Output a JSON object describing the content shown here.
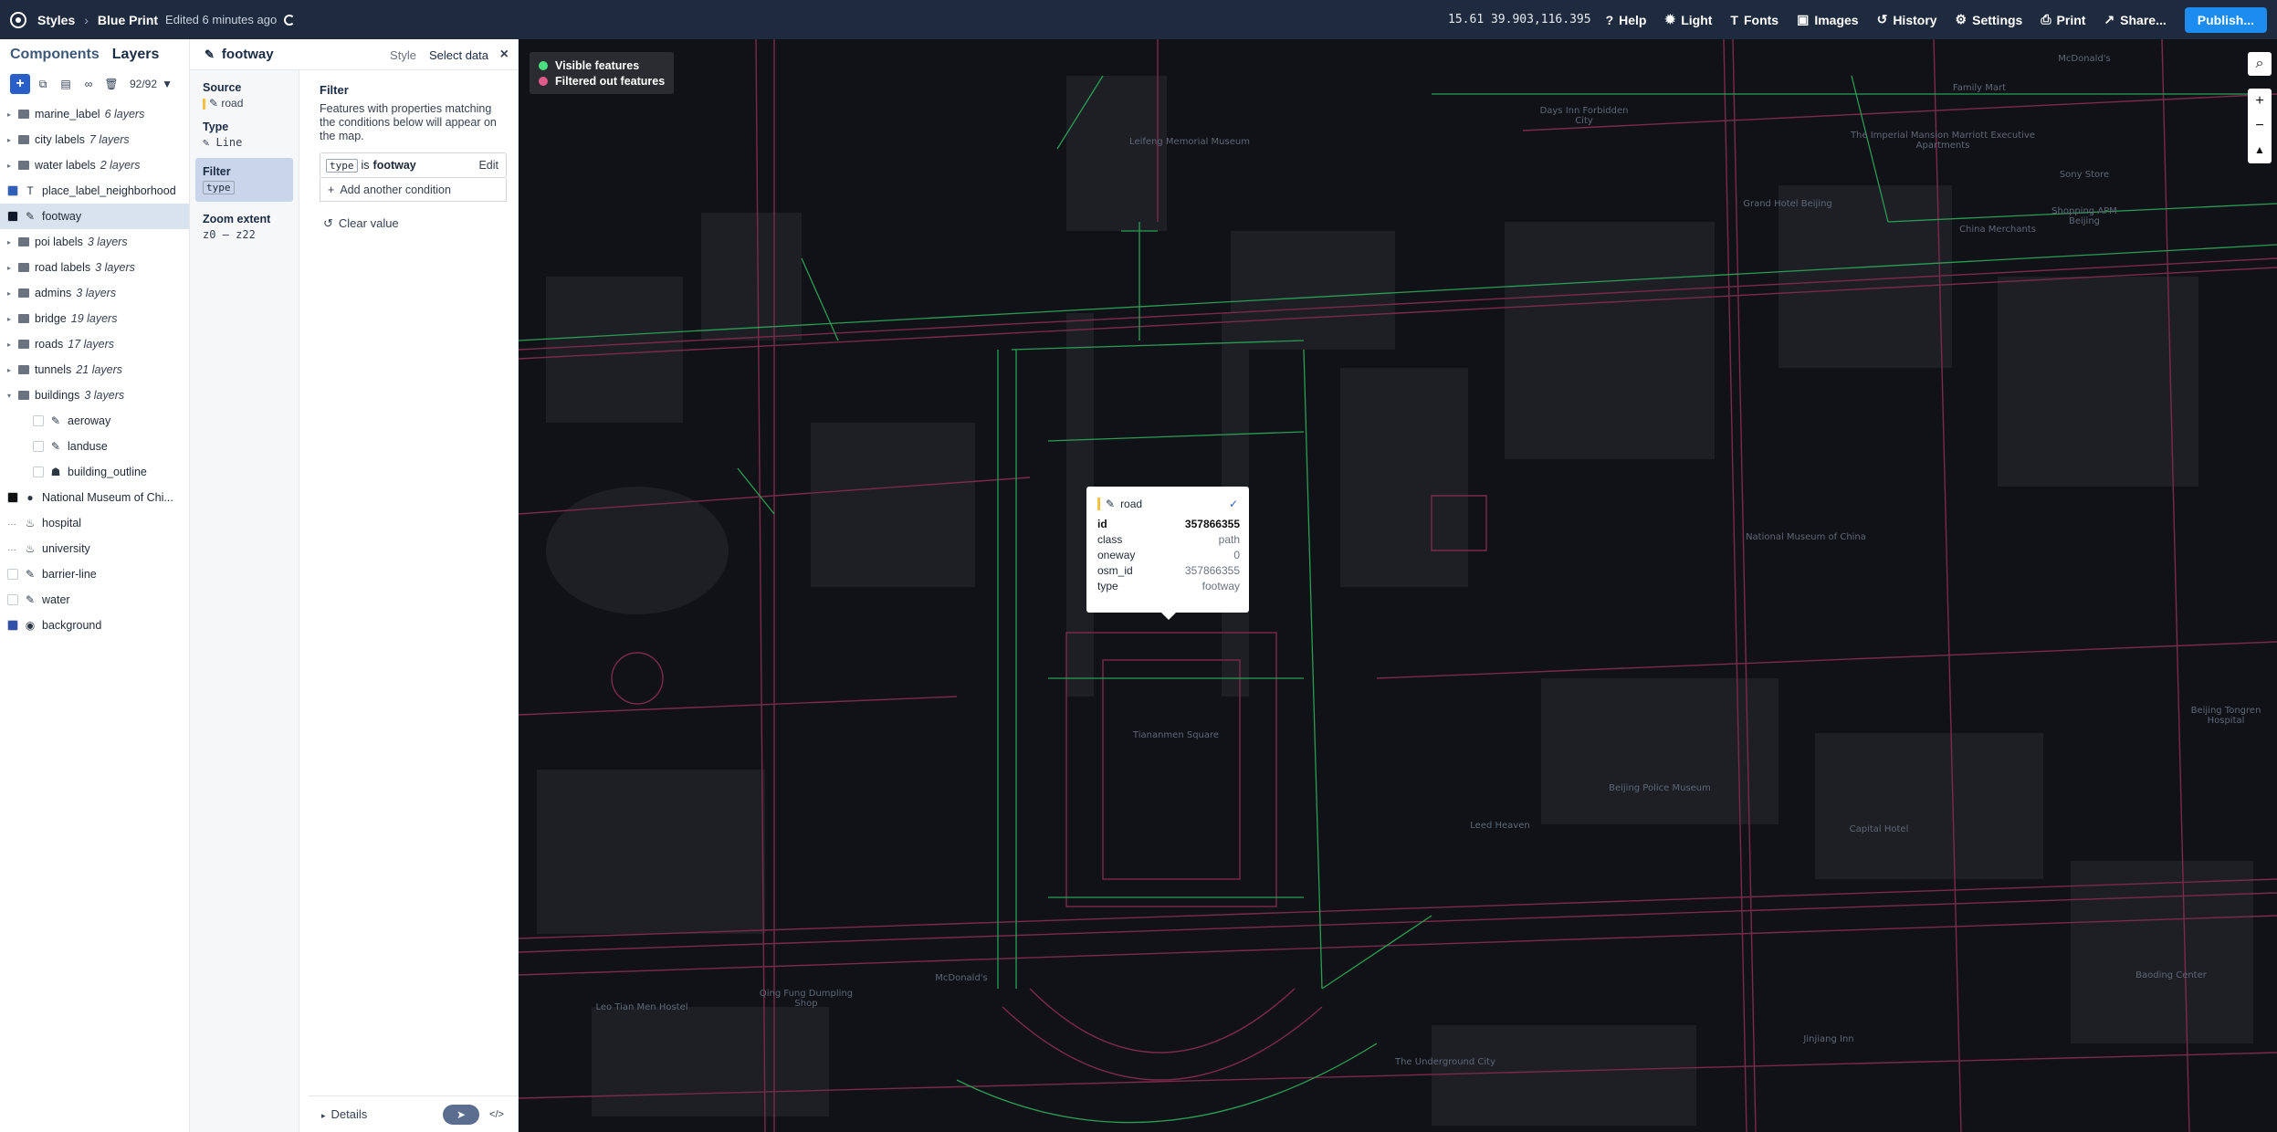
{
  "topbar": {
    "styles_label": "Styles",
    "style_name": "Blue Print",
    "edited": "Edited 6 minutes ago",
    "coords": "15.61 39.903,116.395",
    "buttons": [
      "Help",
      "Light",
      "Fonts",
      "Images",
      "History",
      "Settings",
      "Print",
      "Share..."
    ],
    "icons": [
      "help-icon",
      "light-icon",
      "fonts-icon",
      "images-icon",
      "history-icon",
      "settings-icon",
      "print-icon",
      "share-icon"
    ],
    "publish": "Publish..."
  },
  "leftpanel": {
    "tabs": [
      "Components",
      "Layers"
    ],
    "count": "92/92",
    "layers": [
      {
        "name": "marine_label",
        "count": "6 layers",
        "kind": "group"
      },
      {
        "name": "city labels",
        "count": "7 layers",
        "kind": "group"
      },
      {
        "name": "water labels",
        "count": "2 layers",
        "kind": "group"
      },
      {
        "name": "place_label_neighborhood",
        "kind": "symbol",
        "swatch": "#2f5fb8"
      },
      {
        "name": "footway",
        "kind": "line",
        "swatch": "#0f172a",
        "selected": true
      },
      {
        "name": "poi labels",
        "count": "3 layers",
        "kind": "group"
      },
      {
        "name": "road labels",
        "count": "3 layers",
        "kind": "group"
      },
      {
        "name": "admins",
        "count": "3 layers",
        "kind": "group"
      },
      {
        "name": "bridge",
        "count": "19 layers",
        "kind": "group"
      },
      {
        "name": "roads",
        "count": "17 layers",
        "kind": "group"
      },
      {
        "name": "tunnels",
        "count": "21 layers",
        "kind": "group"
      },
      {
        "name": "buildings",
        "count": "3 layers",
        "kind": "group-open"
      },
      {
        "name": "aeroway",
        "kind": "line",
        "indent": true,
        "swatch": "#ffffff"
      },
      {
        "name": "landuse",
        "kind": "line",
        "indent": true,
        "swatch": "#ffffff"
      },
      {
        "name": "building_outline",
        "kind": "fill",
        "indent": true,
        "swatch": "#ffffff"
      },
      {
        "name": "National Museum of Chi...",
        "kind": "circle",
        "swatch": "#111111"
      },
      {
        "name": "hospital",
        "kind": "heatmap",
        "swatch": "none"
      },
      {
        "name": "university",
        "kind": "heatmap",
        "swatch": "none"
      },
      {
        "name": "barrier-line",
        "kind": "line",
        "swatch": "#ffffff"
      },
      {
        "name": "water",
        "kind": "line",
        "swatch": "#ffffff"
      },
      {
        "name": "background",
        "kind": "background",
        "swatch": "#2f4fa8"
      }
    ]
  },
  "midpanel": {
    "layer_name": "footway",
    "tabs": [
      "Style",
      "Select data"
    ],
    "source_label": "Source",
    "source_value": "road",
    "type_label": "Type",
    "type_value": "Line",
    "filter_label": "Filter",
    "filter_chip": "type",
    "zoom_label": "Zoom extent",
    "zoom_value": "z0 – z22",
    "filter_title": "Filter",
    "filter_desc": "Features with properties matching the conditions below will appear on the map.",
    "cond_key": "type",
    "cond_op": "is",
    "cond_val": "footway",
    "edit": "Edit",
    "add_condition": "Add another condition",
    "clear_value": "Clear value",
    "details": "Details"
  },
  "map": {
    "legend": [
      {
        "label": "Visible features",
        "color": "#4ade80"
      },
      {
        "label": "Filtered out features",
        "color": "#e05a8a"
      }
    ],
    "popup": {
      "title": "road",
      "rows": [
        {
          "k": "id",
          "v": "357866355"
        },
        {
          "k": "class",
          "v": "path"
        },
        {
          "k": "oneway",
          "v": "0"
        },
        {
          "k": "osm_id",
          "v": "357866355"
        },
        {
          "k": "type",
          "v": "footway"
        }
      ]
    },
    "labels": [
      {
        "t": "Days Inn Forbidden City"
      },
      {
        "t": "Leifeng Memorial Museum"
      },
      {
        "t": "The Imperial Mansion Marriott Executive Apartments"
      },
      {
        "t": "Grand Hotel Beijing"
      },
      {
        "t": "China Merchants"
      },
      {
        "t": "Shopping APM Beijing"
      },
      {
        "t": "National Museum of China"
      },
      {
        "t": "Beijing Police Museum"
      },
      {
        "t": "Capital Hotel"
      },
      {
        "t": "Leed Heaven"
      },
      {
        "t": "Qing Fung Dumpling Shop"
      },
      {
        "t": "Leo Tian Men Hostel"
      },
      {
        "t": "McDonald's"
      },
      {
        "t": "The Underground City"
      },
      {
        "t": "Jinjiang Inn"
      },
      {
        "t": "Baoding Center"
      },
      {
        "t": "Beijing Tongren Hospital"
      },
      {
        "t": "Sony Store"
      },
      {
        "t": "Family Mart"
      },
      {
        "t": "McDonald's"
      },
      {
        "t": "Tiananmen Square"
      }
    ]
  }
}
